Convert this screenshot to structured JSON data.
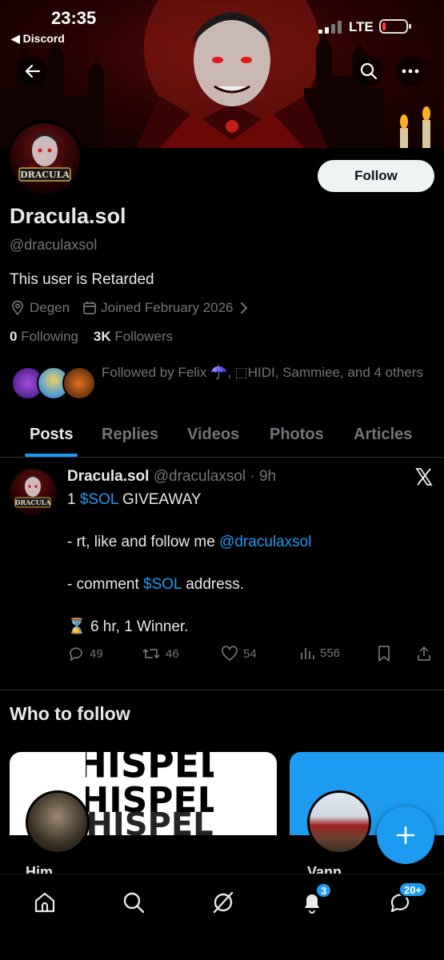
{
  "status_bar": {
    "time": "23:35",
    "back_app": "◀ Discord",
    "network": "LTE",
    "battery_level": 0.15
  },
  "colors": {
    "accent": "#1d9bf0",
    "text_primary": "#e7e9ea",
    "text_secondary": "#71767b",
    "background": "#000000"
  },
  "header": {
    "back_icon": "arrow-left-icon",
    "search_icon": "search-icon",
    "more_icon": "more-icon"
  },
  "profile": {
    "avatar_text": "DRACULA",
    "follow_label": "Follow",
    "display_name": "Dracula.sol",
    "handle": "@draculaxsol",
    "bio": "This user is Retarded",
    "location": "Degen",
    "joined": "Joined February 2026",
    "following_count": "0",
    "following_label": "Following",
    "followers_count": "3K",
    "followers_label": "Followers",
    "followed_by": "Followed by Felix ☂️, ⬚HIDI, Sammiee, and 4 others"
  },
  "tabs": [
    {
      "label": "Posts",
      "active": true
    },
    {
      "label": "Replies",
      "active": false
    },
    {
      "label": "Videos",
      "active": false
    },
    {
      "label": "Photos",
      "active": false
    },
    {
      "label": "Articles",
      "active": false
    }
  ],
  "post": {
    "author": "Dracula.sol",
    "handle_time": "@draculaxsol · 9h",
    "line1_pre": "1 ",
    "line1_link": "$SOL",
    "line1_post": " GIVEAWAY",
    "line2_pre": "- rt, like and follow me ",
    "line2_link": "@draculaxsol",
    "line3_pre": "- comment ",
    "line3_link": "$SOL",
    "line3_post": " address.",
    "line4_icon": "⌛",
    "line4_text": " 6 hr, 1 Winner.",
    "replies": "49",
    "reposts": "46",
    "likes": "54",
    "views": "556"
  },
  "who_to_follow": {
    "title": "Who to follow",
    "cards": [
      {
        "name": "Him",
        "banner_text": "HISPEL"
      },
      {
        "name": "Vann"
      }
    ]
  },
  "bottom_nav": {
    "notifications_badge": "3",
    "messages_badge": "20+"
  }
}
